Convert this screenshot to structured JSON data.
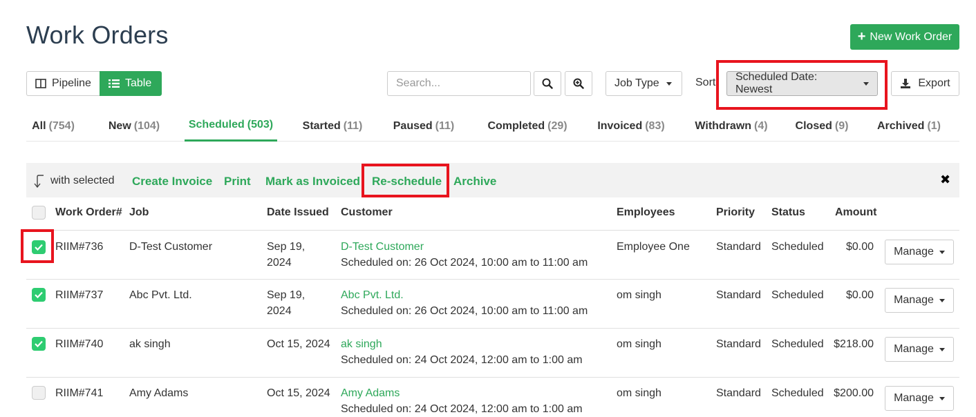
{
  "page": {
    "title": "Work Orders"
  },
  "header": {
    "new_button_label": "New Work Order"
  },
  "view_toggle": {
    "pipeline_label": "Pipeline",
    "table_label": "Table"
  },
  "search": {
    "placeholder": "Search...",
    "value": ""
  },
  "filters": {
    "job_type_label": "Job Type",
    "sort_label": "Sort",
    "sort_value": "Scheduled Date: Newest",
    "export_label": "Export"
  },
  "tabs": [
    {
      "label": "All",
      "count": "(754)"
    },
    {
      "label": "New",
      "count": "(104)"
    },
    {
      "label": "Scheduled",
      "count": "(503)"
    },
    {
      "label": "Started",
      "count": "(11)"
    },
    {
      "label": "Paused",
      "count": "(11)"
    },
    {
      "label": "Completed",
      "count": "(29)"
    },
    {
      "label": "Invoiced",
      "count": "(83)"
    },
    {
      "label": "Withdrawn",
      "count": "(4)"
    },
    {
      "label": "Closed",
      "count": "(9)"
    },
    {
      "label": "Archived",
      "count": "(1)"
    }
  ],
  "active_tab": "Scheduled",
  "bulk_actions": {
    "label": "with selected",
    "actions": [
      "Create Invoice",
      "Print",
      "Mark as Invoiced",
      "Re-schedule",
      "Archive"
    ],
    "close_symbol": "✖"
  },
  "table": {
    "columns": [
      "Work Order#",
      "Job",
      "Date Issued",
      "Customer",
      "Employees",
      "Priority",
      "Status",
      "Amount"
    ],
    "manage_label": "Manage",
    "rows": [
      {
        "checked": true,
        "work_order": "RIIM#736",
        "job": "D-Test Customer",
        "date_line1": "Sep 19,",
        "date_line2": "2024",
        "customer": "D-Test Customer",
        "schedule": "Scheduled on: 26 Oct 2024, 10:00 am to 11:00 am",
        "employees": "Employee One",
        "priority": "Standard",
        "status": "Scheduled",
        "amount": "$0.00"
      },
      {
        "checked": true,
        "work_order": "RIIM#737",
        "job": "Abc Pvt. Ltd.",
        "date_line1": "Sep 19,",
        "date_line2": "2024",
        "customer": "Abc Pvt. Ltd.",
        "schedule": "Scheduled on: 26 Oct 2024, 10:00 am to 11:00 am",
        "employees": "om singh",
        "priority": "Standard",
        "status": "Scheduled",
        "amount": "$0.00"
      },
      {
        "checked": true,
        "work_order": "RIIM#740",
        "job": "ak singh",
        "date_line1": "Oct 15, 2024",
        "date_line2": "",
        "customer": "ak singh",
        "schedule": "Scheduled on: 24 Oct 2024, 12:00 am to 1:00 am",
        "employees": "om singh",
        "priority": "Standard",
        "status": "Scheduled",
        "amount": "$218.00"
      },
      {
        "checked": false,
        "work_order": "RIIM#741",
        "job": "Amy Adams",
        "date_line1": "Oct 15, 2024",
        "date_line2": "",
        "customer": "Amy Adams",
        "schedule": "Scheduled on: 24 Oct 2024, 12:00 am to 1:00 am",
        "employees": "om singh",
        "priority": "Standard",
        "status": "Scheduled",
        "amount": "$200.00"
      }
    ]
  },
  "colors": {
    "accent": "#2ea85a",
    "highlight": "#e8141e",
    "checkbox": "#2ecc71"
  }
}
